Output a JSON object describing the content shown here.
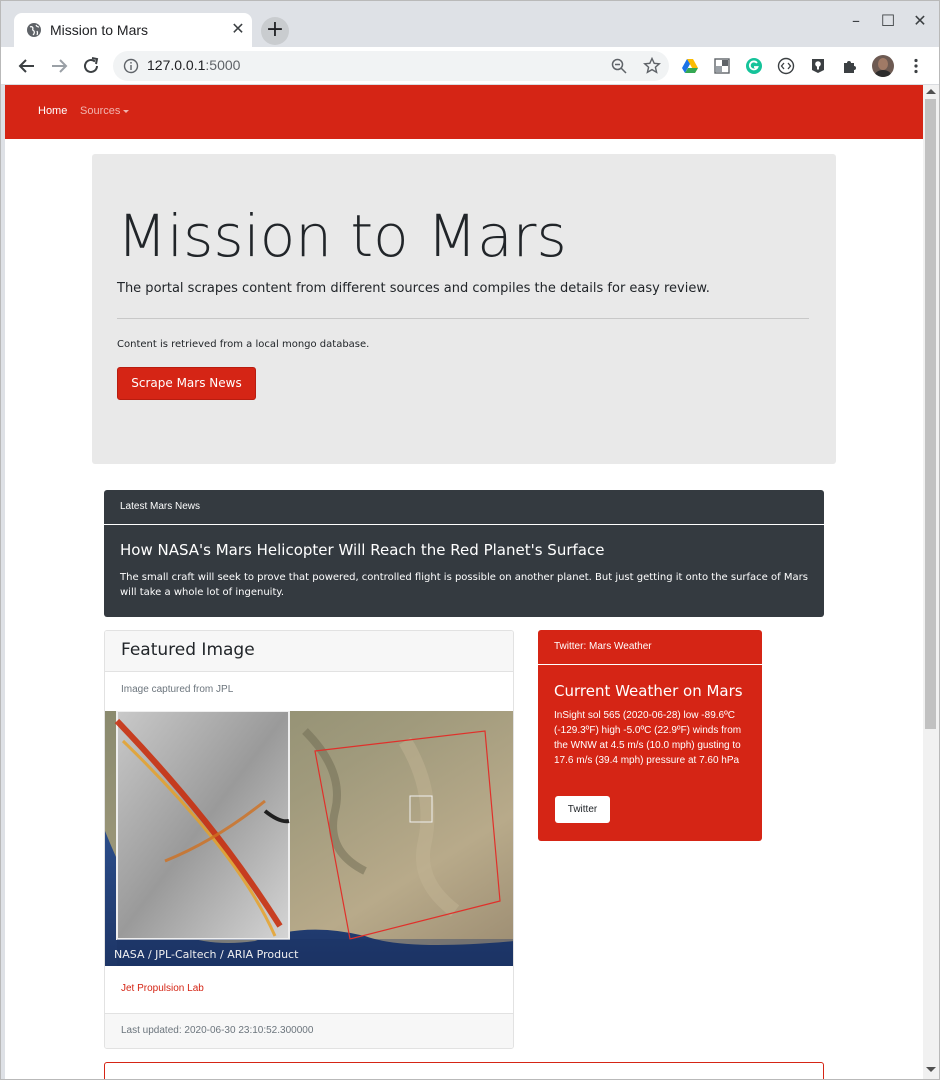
{
  "browser": {
    "tab_title": "Mission to Mars",
    "tab_close": "✕",
    "new_tab": "+",
    "url_host": "127.0.0.1",
    "url_port": ":5000",
    "window_controls": [
      "–",
      "☐",
      "✕"
    ]
  },
  "navbar": {
    "home_label": "Home",
    "sources_label": "Sources"
  },
  "jumbotron": {
    "title": "Mission to Mars",
    "lead": "The portal scrapes content from different sources and compiles the details for easy review.",
    "note": "Content is retrieved from a local mongo database.",
    "scrape_button": "Scrape Mars News"
  },
  "news": {
    "header": "Latest Mars News",
    "title": "How NASA's Mars Helicopter Will Reach the Red Planet's Surface",
    "body": "The small craft will seek to prove that powered, controlled flight is possible on another planet. But just getting it onto the surface of Mars will take a whole lot of ingenuity."
  },
  "featured": {
    "header": "Featured Image",
    "caption": "Image captured from JPL",
    "image_credit": "NASA / JPL-Caltech / ARIA Product",
    "link": "Jet Propulsion Lab",
    "footer": "Last updated: 2020-06-30 23:10:52.300000"
  },
  "weather": {
    "header": "Twitter: Mars Weather",
    "title": "Current Weather on Mars",
    "body": "InSight sol 565 (2020-06-28) low -89.6ºC (-129.3ºF) high -5.0ºC (22.9ºF) winds from the WNW at 4.5 m/s (10.0 mph) gusting to 17.6 m/s (39.4 mph) pressure at 7.60 hPa",
    "button": "Twitter"
  },
  "colors": {
    "brand_red": "#d52515",
    "dark_card": "#343a40",
    "jumbotron_bg": "#e9e9e9"
  }
}
